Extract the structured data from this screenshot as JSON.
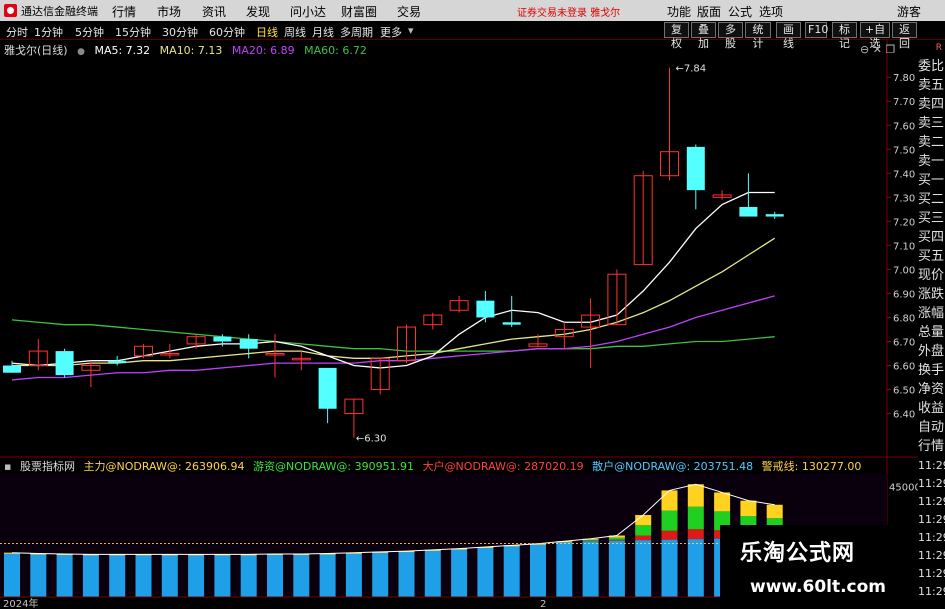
{
  "titlebar": {
    "app_name": "通达信金融终端",
    "menus": [
      "行情",
      "市场",
      "资讯",
      "发现",
      "问小达",
      "财富圈",
      "交易"
    ],
    "login_notice": "证券交易未登录",
    "stock_tag": "雅戈尔",
    "right_menus": [
      "功能",
      "版面",
      "公式",
      "选项",
      "游客"
    ]
  },
  "toolbar": {
    "periods": [
      "分时",
      "1分钟",
      "5分钟",
      "15分钟",
      "30分钟",
      "60分钟",
      "日线",
      "周线",
      "月线",
      "多周期",
      "更多"
    ],
    "active_period": "日线",
    "right_buttons": [
      "复权",
      "叠加",
      "多股",
      "统计",
      "画线",
      "F10",
      "标记",
      "+自选",
      "返回"
    ]
  },
  "chart_title": {
    "name": "雅戈尔(日线)",
    "ma5": "MA5: 7.32",
    "ma10": "MA10: 7.13",
    "ma20": "MA20: 6.89",
    "ma60": "MA60: 6.72"
  },
  "colors": {
    "up": "#ff3232",
    "down": "#54ffff",
    "ma5": "#ffffff",
    "ma10": "#e6e68c",
    "ma20": "#c040ff",
    "ma60": "#40c040",
    "accent": "#ffe14d"
  },
  "right_panel": {
    "top_label": "R",
    "labels": [
      "委比",
      "卖五",
      "卖四",
      "卖三",
      "卖二",
      "卖一",
      "买一",
      "买二",
      "买三",
      "买四",
      "买五",
      "现价",
      "涨跌",
      "涨幅",
      "总量",
      "外盘",
      "换手",
      "净资",
      "收益",
      "自动",
      "行情",
      "11:29",
      "11:29",
      "11:29",
      "11:29",
      "11:29",
      "11:29",
      "11:29",
      "11:29"
    ]
  },
  "indicator": {
    "name": "股票指标网",
    "main": "主力@NODRAW@: 263906.94",
    "hot": "游资@NODRAW@: 390951.91",
    "big": "大户@NODRAW@: 287020.19",
    "retail": "散户@NODRAW@: 203751.48",
    "warn": "警戒线: 130277.00"
  },
  "x_labels": [
    "2024年",
    "2"
  ],
  "watermark": {
    "line1": "乐淘公式网",
    "line2": "www.60lt.com"
  },
  "chart_data": {
    "type": "candlestick",
    "y_ticks": [
      7.8,
      7.7,
      7.6,
      7.5,
      7.4,
      7.3,
      7.2,
      7.1,
      7.0,
      6.9,
      6.8,
      6.7,
      6.6,
      6.5,
      6.4
    ],
    "ohlc": [
      [
        6.6,
        6.62,
        6.57,
        6.57
      ],
      [
        6.6,
        6.71,
        6.58,
        6.66
      ],
      [
        6.66,
        6.67,
        6.55,
        6.56
      ],
      [
        6.58,
        6.62,
        6.51,
        6.6
      ],
      [
        6.62,
        6.64,
        6.6,
        6.61
      ],
      [
        6.64,
        6.69,
        6.63,
        6.68
      ],
      [
        6.65,
        6.69,
        6.63,
        6.65
      ],
      [
        6.69,
        6.73,
        6.67,
        6.72
      ],
      [
        6.72,
        6.73,
        6.68,
        6.7
      ],
      [
        6.71,
        6.73,
        6.63,
        6.67
      ],
      [
        6.65,
        6.73,
        6.55,
        6.65
      ],
      [
        6.63,
        6.66,
        6.58,
        6.63
      ],
      [
        6.59,
        6.59,
        6.36,
        6.42
      ],
      [
        6.4,
        6.46,
        6.3,
        6.46
      ],
      [
        6.5,
        6.63,
        6.48,
        6.63
      ],
      [
        6.62,
        6.77,
        6.61,
        6.76
      ],
      [
        6.77,
        6.82,
        6.75,
        6.81
      ],
      [
        6.83,
        6.89,
        6.82,
        6.87
      ],
      [
        6.87,
        6.91,
        6.78,
        6.8
      ],
      [
        6.78,
        6.89,
        6.76,
        6.77
      ],
      [
        6.68,
        6.73,
        6.68,
        6.69
      ],
      [
        6.72,
        6.78,
        6.67,
        6.75
      ],
      [
        6.76,
        6.88,
        6.59,
        6.81
      ],
      [
        6.77,
        7.0,
        6.77,
        6.98
      ],
      [
        7.02,
        7.41,
        7.02,
        7.39
      ],
      [
        7.39,
        7.84,
        7.37,
        7.49
      ],
      [
        7.51,
        7.52,
        7.25,
        7.33
      ],
      [
        7.3,
        7.33,
        7.29,
        7.31
      ],
      [
        7.26,
        7.4,
        7.23,
        7.22
      ],
      [
        7.23,
        7.24,
        7.21,
        7.22
      ]
    ],
    "annotations": {
      "high": "7.84",
      "low": "6.30"
    },
    "ma": {
      "ma5": [
        6.61,
        6.6,
        6.61,
        6.62,
        6.62,
        6.64,
        6.66,
        6.68,
        6.69,
        6.69,
        6.7,
        6.68,
        6.64,
        6.6,
        6.59,
        6.6,
        6.64,
        6.73,
        6.8,
        6.83,
        6.82,
        6.78,
        6.78,
        6.81,
        6.91,
        7.03,
        7.17,
        7.27,
        7.32,
        7.32
      ],
      "ma10": [
        6.6,
        6.6,
        6.6,
        6.61,
        6.61,
        6.62,
        6.62,
        6.63,
        6.64,
        6.65,
        6.66,
        6.66,
        6.64,
        6.63,
        6.63,
        6.64,
        6.65,
        6.67,
        6.69,
        6.71,
        6.72,
        6.73,
        6.75,
        6.78,
        6.82,
        6.87,
        6.93,
        6.99,
        7.06,
        7.13
      ],
      "ma20": [
        6.54,
        6.55,
        6.55,
        6.56,
        6.57,
        6.57,
        6.58,
        6.58,
        6.59,
        6.6,
        6.61,
        6.61,
        6.61,
        6.61,
        6.62,
        6.62,
        6.63,
        6.64,
        6.65,
        6.66,
        6.67,
        6.67,
        6.68,
        6.7,
        6.73,
        6.76,
        6.8,
        6.83,
        6.86,
        6.89
      ],
      "ma60": [
        6.79,
        6.78,
        6.77,
        6.77,
        6.76,
        6.75,
        6.74,
        6.73,
        6.72,
        6.71,
        6.7,
        6.69,
        6.68,
        6.67,
        6.67,
        6.66,
        6.66,
        6.66,
        6.66,
        6.66,
        6.67,
        6.67,
        6.67,
        6.68,
        6.68,
        6.69,
        6.7,
        6.7,
        6.71,
        6.72
      ]
    },
    "indicator_tick": "45000",
    "flow": {
      "main": [
        100,
        100,
        100,
        100,
        100,
        100,
        100,
        100,
        100,
        100,
        100,
        100,
        100,
        100,
        100,
        100,
        100,
        100,
        100,
        100,
        100,
        105,
        108,
        112,
        118,
        263906,
        260000,
        230000,
        215000,
        200000
      ],
      "total": [
        108000,
        106000,
        105000,
        104000,
        104000,
        104000,
        104000,
        104000,
        104000,
        104000,
        105000,
        105000,
        106000,
        108000,
        110000,
        112000,
        115000,
        118000,
        122000,
        126000,
        130000,
        136000,
        142000,
        150000,
        200000,
        260000,
        275000,
        255000,
        235000,
        225000
      ]
    }
  }
}
